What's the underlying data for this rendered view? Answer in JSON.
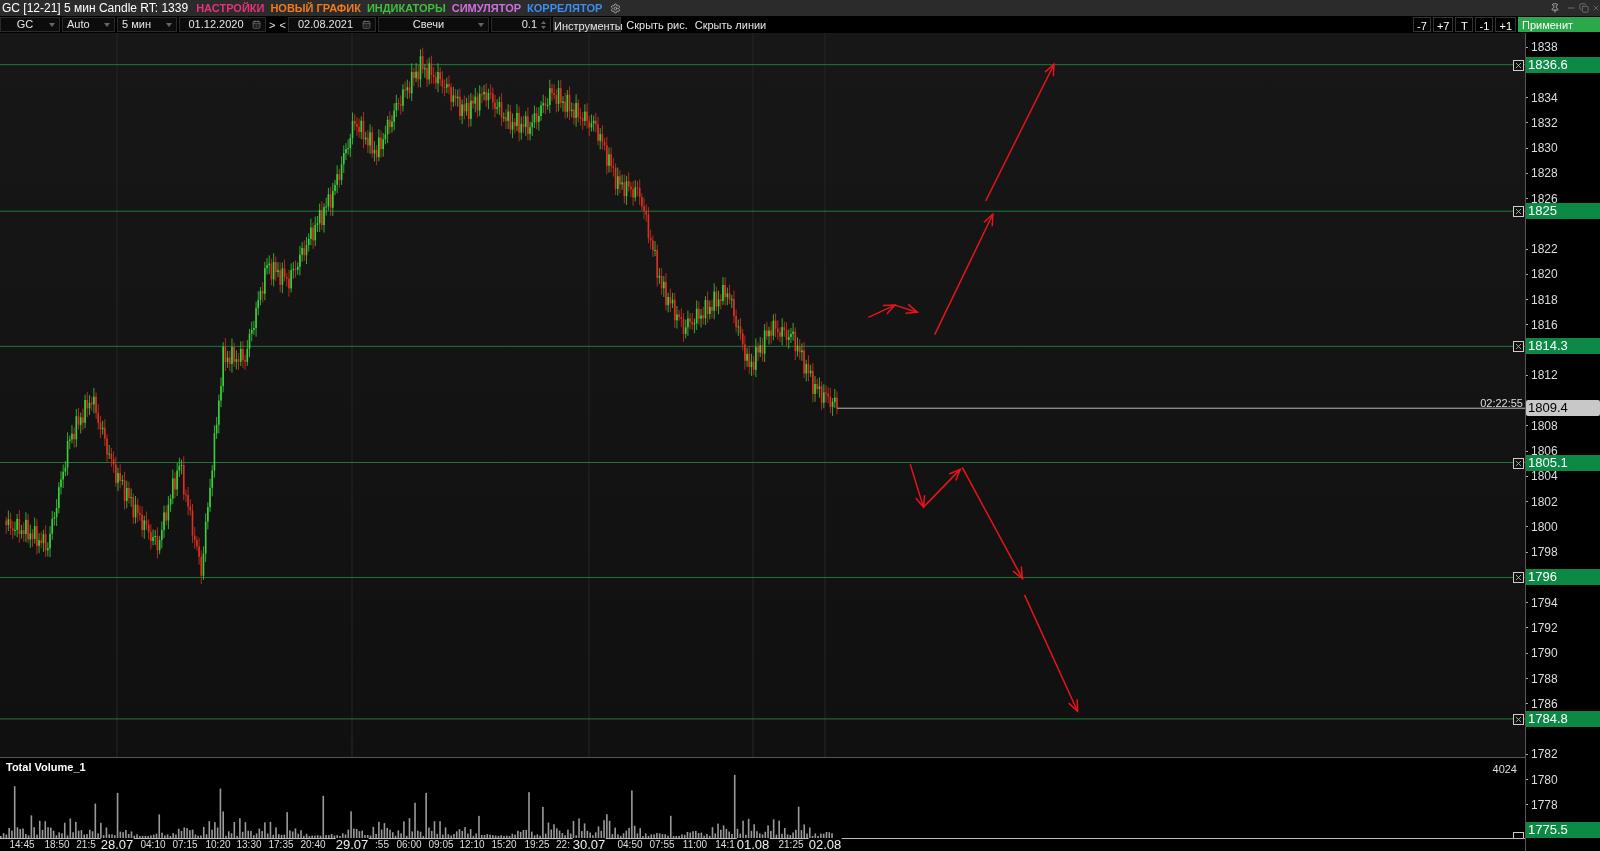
{
  "title_bar": {
    "title": "GC [12-21] 5 мин Candle RT: 1339",
    "menu": [
      {
        "label": "НАСТРОЙКИ",
        "color": "#e8317a"
      },
      {
        "label": "НОВЫЙ ГРАФИК",
        "color": "#f07b1a"
      },
      {
        "label": "ИНДИКАТОРЫ",
        "color": "#3cc13c"
      },
      {
        "label": "СИМУЛЯТОР",
        "color": "#d070e0"
      },
      {
        "label": "КОРРЕЛЯТОР",
        "color": "#3b8ff0"
      }
    ]
  },
  "toolbar": {
    "items": [
      {
        "kind": "dropdown",
        "value": "GC"
      },
      {
        "kind": "dropdown",
        "value": "Auto"
      },
      {
        "kind": "dropdown",
        "value": "5 мин"
      },
      {
        "kind": "date",
        "value": "01.12.2020"
      },
      {
        "kind": "nav",
        "labels": [
          ">",
          "<"
        ]
      },
      {
        "kind": "date",
        "value": "02.08.2021"
      },
      {
        "kind": "dropdown",
        "value": "Свечи"
      },
      {
        "kind": "number",
        "value": "0.1"
      },
      {
        "kind": "button",
        "value": "Инструменты"
      },
      {
        "kind": "link",
        "value": "Скрыть рис."
      },
      {
        "kind": "link",
        "value": "Скрыть линии"
      }
    ],
    "right_buttons": [
      "-7",
      "+7",
      "T",
      "-1",
      "+1"
    ],
    "apply_button": "Применит"
  },
  "chart": {
    "price_axis": [
      "1838",
      "1834",
      "1832",
      "1830",
      "1828",
      "1826",
      "1822",
      "1820",
      "1818",
      "1816",
      "1812",
      "1808",
      "1806",
      "1804",
      "1802",
      "1800",
      "1798",
      "1794",
      "1792",
      "1790",
      "1788",
      "1786",
      "1782",
      "1780",
      "1778"
    ],
    "time_axis": [
      {
        "label": "14:45",
        "kind": "time"
      },
      {
        "label": "18:50",
        "kind": "time"
      },
      {
        "label": "21:5",
        "kind": "time"
      },
      {
        "label": "28.07",
        "kind": "date"
      },
      {
        "label": "04:10",
        "kind": "time"
      },
      {
        "label": "07:15",
        "kind": "time"
      },
      {
        "label": "10:20",
        "kind": "time"
      },
      {
        "label": "13:30",
        "kind": "time"
      },
      {
        "label": "17:35",
        "kind": "time"
      },
      {
        "label": "20:40",
        "kind": "time"
      },
      {
        "label": "29.07",
        "kind": "date"
      },
      {
        "label": ":55",
        "kind": "time"
      },
      {
        "label": "06:00",
        "kind": "time"
      },
      {
        "label": "09:05",
        "kind": "time"
      },
      {
        "label": "12:10",
        "kind": "time"
      },
      {
        "label": "15:20",
        "kind": "time"
      },
      {
        "label": "19:25",
        "kind": "time"
      },
      {
        "label": "22:",
        "kind": "time"
      },
      {
        "label": "30.07",
        "kind": "date"
      },
      {
        "label": "04:50",
        "kind": "time"
      },
      {
        "label": "07:55",
        "kind": "time"
      },
      {
        "label": "11:00",
        "kind": "time"
      },
      {
        "label": "14:1",
        "kind": "time"
      },
      {
        "label": "01.08",
        "kind": "date"
      },
      {
        "label": "21:25",
        "kind": "time"
      },
      {
        "label": "02.08",
        "kind": "date"
      }
    ],
    "levels": [
      {
        "label": "1836.6"
      },
      {
        "label": "1825"
      },
      {
        "label": "1814.3"
      },
      {
        "label": "1805.1"
      },
      {
        "label": "1796"
      },
      {
        "label": "1784.8"
      }
    ],
    "current_price": {
      "label": "1809.4",
      "time": "02:22:55"
    },
    "volume": {
      "title": "Total Volume_1",
      "max": "4024",
      "bottom_label": "1775.5"
    }
  }
}
